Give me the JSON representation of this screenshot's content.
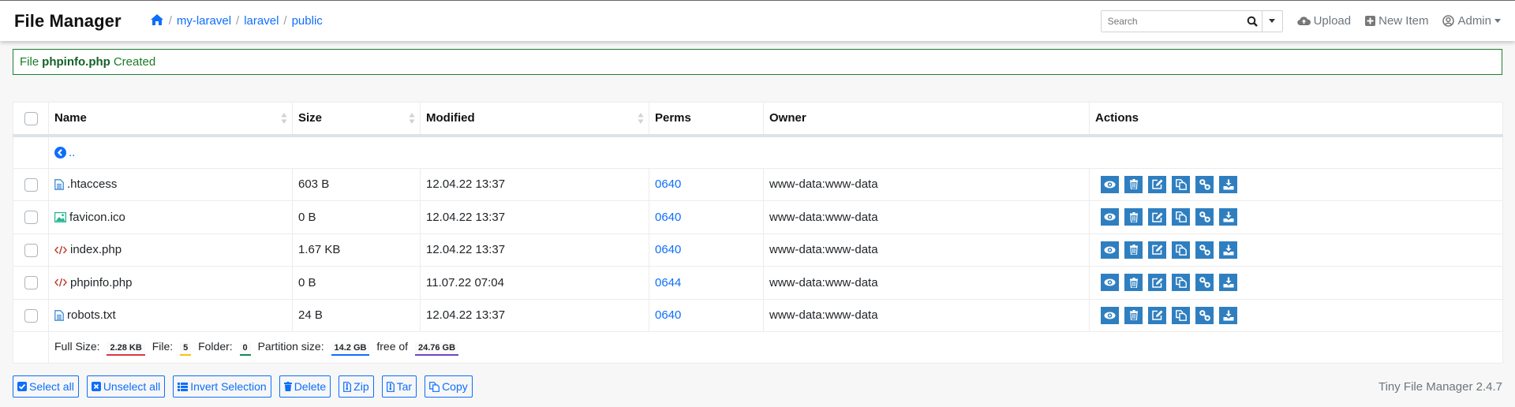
{
  "header": {
    "brand": "File Manager",
    "breadcrumb": [
      {
        "label": "my-laravel"
      },
      {
        "label": "laravel"
      },
      {
        "label": "public"
      }
    ],
    "search_placeholder": "Search",
    "upload_label": "Upload",
    "new_item_label": "New Item",
    "user_label": "Admin"
  },
  "alert": {
    "prefix": "File",
    "filename": "phpinfo.php",
    "suffix": "Created",
    "color": "#1e7e34"
  },
  "table": {
    "columns": [
      "Name",
      "Size",
      "Modified",
      "Perms",
      "Owner",
      "Actions"
    ],
    "parent_label": "..",
    "rows": [
      {
        "name": ".htaccess",
        "icon": "file-text-icon",
        "size": "603 B",
        "modified": "12.04.22 13:37",
        "perms": "0640",
        "owner": "www-data:www-data"
      },
      {
        "name": "favicon.ico",
        "icon": "image-icon",
        "size": "0 B",
        "modified": "12.04.22 13:37",
        "perms": "0640",
        "owner": "www-data:www-data"
      },
      {
        "name": "index.php",
        "icon": "code-icon",
        "size": "1.67 KB",
        "modified": "12.04.22 13:37",
        "perms": "0640",
        "owner": "www-data:www-data"
      },
      {
        "name": "phpinfo.php",
        "icon": "code-icon",
        "size": "0 B",
        "modified": "11.07.22 07:04",
        "perms": "0644",
        "owner": "www-data:www-data"
      },
      {
        "name": "robots.txt",
        "icon": "file-text-icon",
        "size": "24 B",
        "modified": "12.04.22 13:37",
        "perms": "0640",
        "owner": "www-data:www-data"
      }
    ],
    "row_actions": [
      "view",
      "delete",
      "rename",
      "copy",
      "direct-link",
      "download"
    ],
    "footer": {
      "full_size_label": "Full Size:",
      "full_size": "2.28 KB",
      "file_label": "File:",
      "file_count": "5",
      "folder_label": "Folder:",
      "folder_count": "0",
      "partition_label": "Partition size:",
      "partition_size": "14.2 GB",
      "free_of_label": "free of",
      "total_size": "24.76 GB",
      "colors": {
        "full_size": "#dc3545",
        "file": "#ffc107",
        "folder": "#198754",
        "partition": "#0d6efd",
        "total": "#6f42c1"
      }
    }
  },
  "bulk_actions": {
    "select_all": "Select all",
    "unselect_all": "Unselect all",
    "invert": "Invert Selection",
    "delete": "Delete",
    "zip": "Zip",
    "tar": "Tar",
    "copy": "Copy"
  },
  "version": "Tiny File Manager 2.4.7",
  "colors": {
    "accent": "#0d6efd",
    "action_button": "#2f7fc0"
  }
}
